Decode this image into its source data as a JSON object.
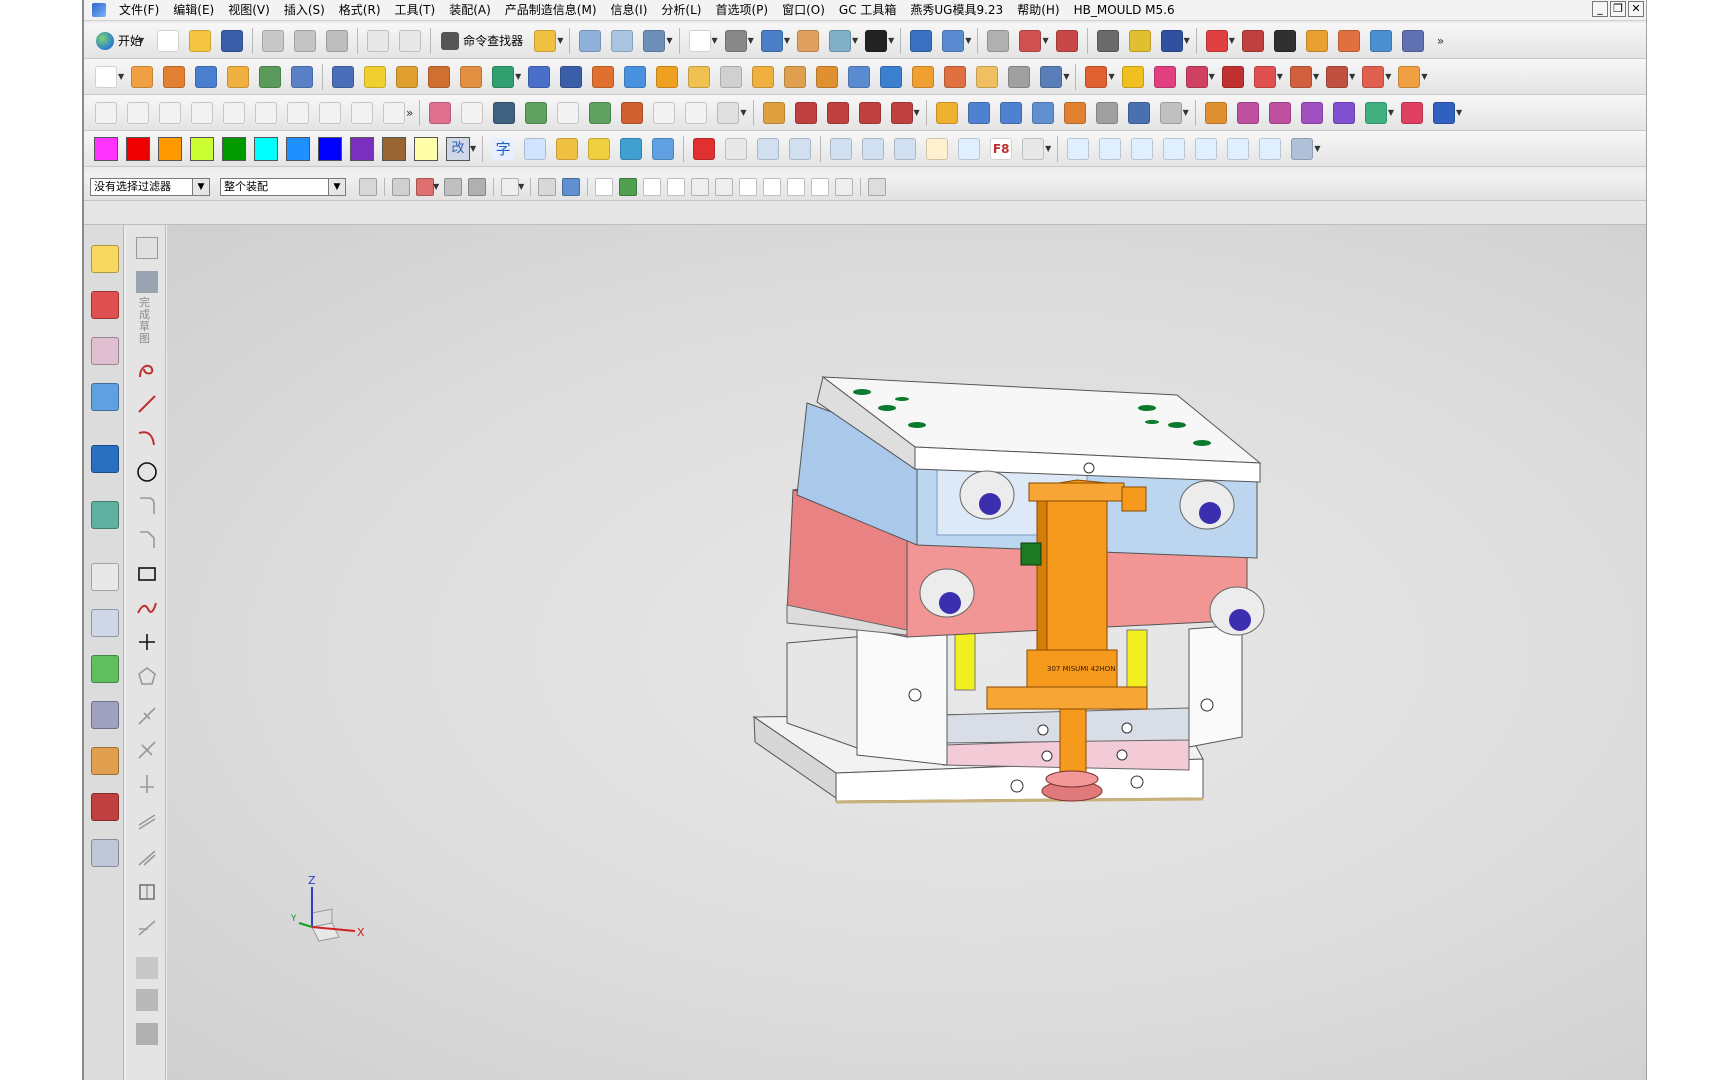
{
  "menu": [
    "文件(F)",
    "编辑(E)",
    "视图(V)",
    "插入(S)",
    "格式(R)",
    "工具(T)",
    "装配(A)",
    "产品制造信息(M)",
    "信息(I)",
    "分析(L)",
    "首选项(P)",
    "窗口(O)",
    "GC 工具箱",
    "燕秀UG模具9.23",
    "帮助(H)",
    "HB_MOULD M5.6"
  ],
  "window_buttons": {
    "minimize": "_",
    "restore": "❐",
    "close": "✕"
  },
  "toolbar": {
    "start_label": "开始",
    "command_finder_label": "命令查找器",
    "more_glyph": "»",
    "color_palette": [
      "#ff33ff",
      "#ee0000",
      "#ff9900",
      "#ccff33",
      "#009900",
      "#00ffff",
      "#1e90ff",
      "#0000ff",
      "#7b2fbe",
      "#996633",
      "#ffffaa"
    ],
    "palette_edit_label": "改",
    "font_label": "字",
    "f8_label": "F8"
  },
  "selection_bar": {
    "filter_value": "没有选择过滤器",
    "scope_value": "整个装配"
  },
  "sketch_bar": {
    "finish_label": "完成草图"
  },
  "triad": {
    "x": "X",
    "y": "Y",
    "z": "Z"
  },
  "model": {
    "plate_labels": "307 MISUMI 42HON",
    "colors": {
      "top_clamp": "#f4f4f4",
      "cavity_plate": "#a9c8ea",
      "core_plate": "#f08d8d",
      "slide": "#f59a1c",
      "support_pillars": "#f2f01e",
      "ejector_plates": "#f3cbd6",
      "guide_bushings": "#3b2fb0"
    }
  }
}
